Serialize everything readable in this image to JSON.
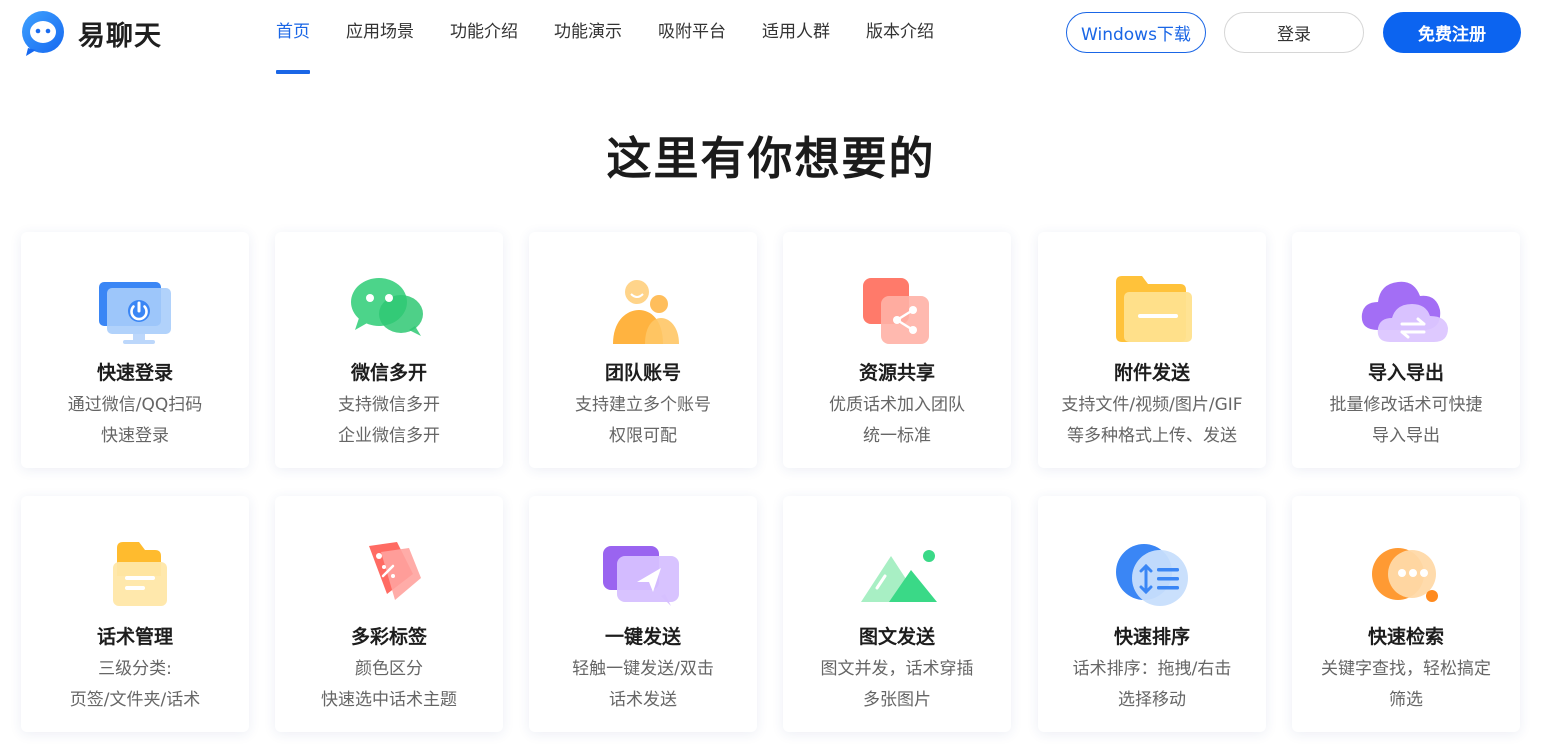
{
  "brand": {
    "name": "易聊天"
  },
  "nav": [
    {
      "label": "首页",
      "active": true
    },
    {
      "label": "应用场景"
    },
    {
      "label": "功能介绍"
    },
    {
      "label": "功能演示"
    },
    {
      "label": "吸附平台"
    },
    {
      "label": "适用人群"
    },
    {
      "label": "版本介绍"
    }
  ],
  "actions": {
    "download": "Windows下载",
    "login": "登录",
    "register": "免费注册"
  },
  "main": {
    "title": "这里有你想要的"
  },
  "features": [
    {
      "title": "快速登录",
      "line1": "通过微信/QQ扫码",
      "line2": "快速登录",
      "icon": "monitor-power-icon"
    },
    {
      "title": "微信多开",
      "line1": "支持微信多开",
      "line2": "企业微信多开",
      "icon": "wechat-bubbles-icon"
    },
    {
      "title": "团队账号",
      "line1": "支持建立多个账号",
      "line2": "权限可配",
      "icon": "team-users-icon"
    },
    {
      "title": "资源共享",
      "line1": "优质话术加入团队",
      "line2": "统一标准",
      "icon": "share-icon"
    },
    {
      "title": "附件发送",
      "line1": "支持文件/视频/图片/GIF",
      "line2": "等多种格式上传、发送",
      "icon": "folder-icon"
    },
    {
      "title": "导入导出",
      "line1": "批量修改话术可快捷",
      "line2": "导入导出",
      "icon": "cloud-sync-icon"
    },
    {
      "title": "话术管理",
      "line1": "三级分类:",
      "line2": "页签/文件夹/话术",
      "icon": "folder-doc-icon"
    },
    {
      "title": "多彩标签",
      "line1": "颜色区分",
      "line2": "快速选中话术主题",
      "icon": "tags-icon"
    },
    {
      "title": "一键发送",
      "line1": "轻触一键发送/双击",
      "line2": "话术发送",
      "icon": "send-icon"
    },
    {
      "title": "图文发送",
      "line1": "图文并发，话术穿插",
      "line2": "多张图片",
      "icon": "image-mountain-icon"
    },
    {
      "title": "快速排序",
      "line1": "话术排序：拖拽/右击",
      "line2": "选择移动",
      "icon": "sort-icon"
    },
    {
      "title": "快速检索",
      "line1": "关键字查找，轻松搞定",
      "line2": "筛选",
      "icon": "search-bubble-icon"
    }
  ],
  "colors": {
    "accent": "#1a66e6",
    "register_bg": "#0c64f0"
  }
}
